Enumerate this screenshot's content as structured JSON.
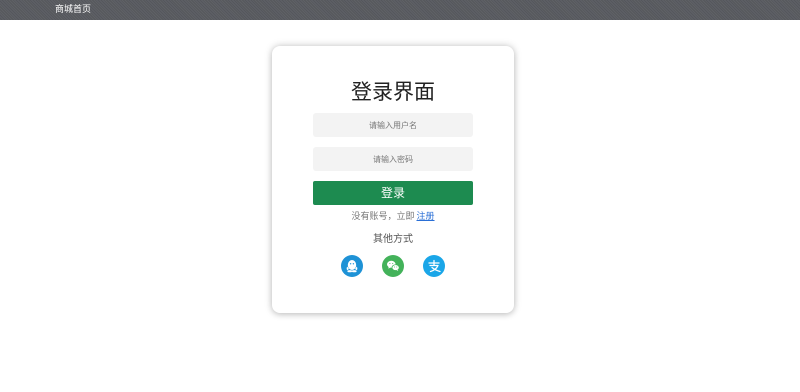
{
  "nav": {
    "home_link": "商城首页"
  },
  "login": {
    "title": "登录界面",
    "username_placeholder": "请输入用户名",
    "password_placeholder": "请输入密码",
    "login_button": "登录",
    "no_account_text": "没有账号，立即",
    "register_link": "注册",
    "other_methods": "其他方式"
  },
  "social": [
    {
      "icon": "qq-icon",
      "color": "#1e92d6"
    },
    {
      "icon": "wechat-icon",
      "color": "#43b25a"
    },
    {
      "icon": "alipay-icon",
      "color": "#1aa6e8"
    }
  ]
}
